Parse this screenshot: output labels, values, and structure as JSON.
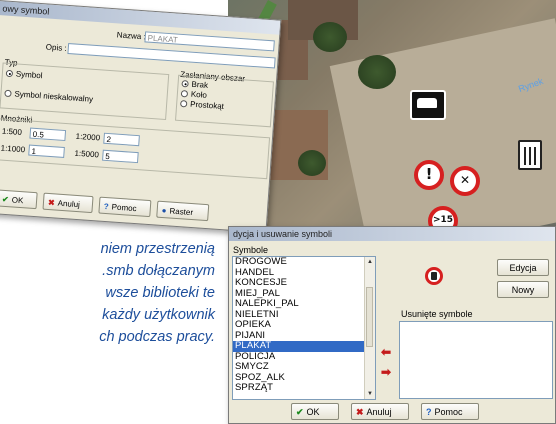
{
  "document": {
    "lines": [
      "niem przestrzenią",
      ".smb dołączanym",
      "wsze biblioteki te",
      "każdy użytkownik",
      "ch podczas pracy."
    ]
  },
  "map": {
    "street_label": "Rynek",
    "symbols": [
      "car-sign-icon",
      "exclamation-sign-icon",
      "no-drinking-sign-icon",
      "trash-bin-icon",
      "speed-sign-icon"
    ]
  },
  "new_symbol_dialog": {
    "title": "owy symbol",
    "name_label": "Nazwa :",
    "name_value": "PLAKAT",
    "desc_label": "Opis :",
    "desc_value": "",
    "type_label": "Typ",
    "type_options": [
      "Symbol",
      "Symbol nieskalowalny"
    ],
    "cover_label": "Zasłaniany obszar",
    "cover_options": [
      "Brak",
      "Koło",
      "Prostokąt"
    ],
    "scale_label": "Mnożniki",
    "scales": [
      {
        "label": "1:500",
        "value": "0.5"
      },
      {
        "label": "1:2000",
        "value": "2"
      },
      {
        "label": "1:1000",
        "value": "1"
      },
      {
        "label": "1:5000",
        "value": "5"
      }
    ],
    "buttons": {
      "ok": "OK",
      "cancel": "Anuluj",
      "help": "Pomoc",
      "raster": "Raster"
    }
  },
  "edit_dialog": {
    "title": "dycja i usuwanie symboli",
    "symbols_label": "Symbole",
    "symbols": [
      "DROGOWE",
      "HANDEL",
      "KONCESJE",
      "MIEJ_PAL",
      "NALEPKI_PAL",
      "NIELETNI",
      "OPIEKA",
      "PIJANI",
      "PLAKAT",
      "POLICJA",
      "SMYCZ",
      "SPOZ_ALK",
      "SPRZĄT"
    ],
    "selected": "PLAKAT",
    "removed_label": "Usunięte symbole",
    "buttons": {
      "edit": "Edycja",
      "new": "Nowy",
      "ok": "OK",
      "cancel": "Anuluj",
      "help": "Pomoc"
    }
  },
  "colors": {
    "selection": "#316ac5",
    "text_blue": "#1d4e9b",
    "sign_red": "#d62020"
  }
}
